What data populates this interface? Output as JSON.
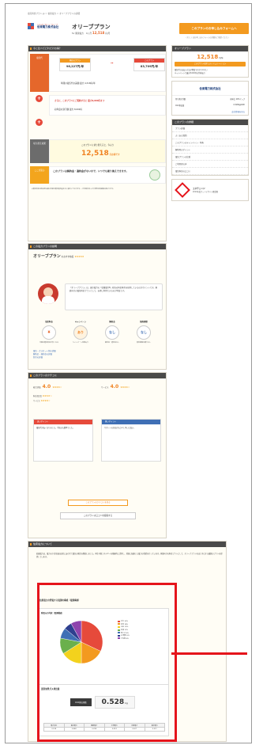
{
  "breadcrumb": "電気料金プラン.jp ＞ 伯東電力 ＞ オリーブプランの詳細",
  "company": {
    "name": "伯東電力株式会社",
    "tag": "エネルギーのニューウェーブ"
  },
  "plan": {
    "title": "オリーブプラン",
    "meta_prefix": "for 関東電力 　6ヶ月",
    "price": "12,518",
    "unit": "円/月"
  },
  "header_cta": {
    "label": "このプランのお申し込みフォームへ",
    "note": "くわしくはお申し込みフォームの詳細をご確認ください"
  },
  "summary": {
    "heading": "今と比べてどれだけお得？",
    "rows": [
      {
        "label": "電気代",
        "color": "#e5672b",
        "cols": [
          {
            "head": "現在のプラン",
            "value": "96,227円/年"
          },
          {
            "head": "このプラン",
            "value": "83,709円/年"
          }
        ],
        "note": "年間の電気代の差額 最大 4,518円/年",
        "highlight": "4,518"
      },
      {
        "label": "キャンペーン特典",
        "color": "#e64a3b",
        "lead": "さらに、このプランにご契約すると 最大8,000円オフ",
        "note": "初年度の割引額 最大 8,000円",
        "highlight": "8,000"
      },
      {
        "label": "切り替え効果",
        "color": "#6c6c6c",
        "lead": "このプランに切り替えると、今より",
        "value": "12,518",
        "unit": "円お得です"
      },
      {
        "label": "ここが安心",
        "color": "#f3a51d",
        "lead": "このプランは解約金・違約金がないので、いつでも乗り換えできます。"
      }
    ],
    "footnote": "※電気料金の削減見込額は年間の電気使用量を元に算出しております。ご利用状況により実際の削減額は異なります。"
  },
  "sidebar": {
    "plan_box": {
      "title": "オリーブプラン",
      "price": "12,518",
      "unit": "円/年",
      "cta": "このプランの詳しいシミュレーション"
    },
    "points": [
      "電気代の支払い方法が豊富でわかりやすい",
      "キャンペーンで最大8,000円の特典あり"
    ],
    "company_box": {
      "name": "伯東電力株式会社",
      "link": "会社情報を見る"
    },
    "stats": [
      {
        "k": "切り替え件数",
        "v": "前年比 20%アップ"
      },
      {
        "k": "CO2排出量",
        "v": "0.528kg/kWh"
      }
    ],
    "nav_head": "このプランの詳細",
    "nav_items": [
      "プラン詳細",
      "よくある質問",
      "このプランのキャンペーン・特典",
      "解約時のポイント",
      "電気プランの比較",
      "ご利用者の声",
      "電気料金の口コミ"
    ],
    "badge": {
      "title": "エネチェンジ",
      "sub": "2019年度グッドデザイン賞受賞"
    }
  },
  "about": {
    "heading": "この電力プランの説明",
    "title": "オリーブプラン",
    "sub": "のおすすめ度",
    "stars": "★★★★★",
    "bubble": "「オリーブプラン」は、東京電力の「従量電灯B」相当の料金体系を採用しているのがポイントです。家庭向けの電気料金プランとして、お得に利用できるのが特長です。",
    "features": [
      {
        "title": "電気料金",
        "icon": "¥",
        "desc": "年間の電気料金が安くなる"
      },
      {
        "title": "キャンペーン",
        "icon": "あり",
        "desc": "キャンペーン特典あり"
      },
      {
        "title": "解約金",
        "icon": "なし",
        "desc": "解約金・違約金なし"
      },
      {
        "title": "契約期間",
        "icon": "なし",
        "desc": "契約期間の縛りなし"
      }
    ],
    "links": [
      "電気・ガスセット割の詳細",
      "解約金・違約金の詳細",
      "割引の詳細"
    ]
  },
  "reviews": {
    "heading": "このプランのクチコミ",
    "scores": [
      {
        "k": "総合評価",
        "v": "4.0"
      },
      {
        "k": "サービス",
        "v": "4.0"
      }
    ],
    "sub_scores": [
      "料金満足度",
      "サービス",
      "手続き",
      "サポート"
    ],
    "cards": [
      {
        "head": "良いポイント",
        "color": "#e64a3b",
        "text": "電気代が安くなりました。手続きも簡単でした。"
      },
      {
        "head": "悪いポイント",
        "color": "#3f6fb5",
        "text": "サポートの対応がもう少し早いと良い。"
      }
    ],
    "more": "このプランのクチコミを見る",
    "more2": "このプランの口コミを投稿する"
  },
  "power": {
    "heading": "伯東電力について",
    "text": "伯東電力は、電力の小売全面自由化にあわせて電気の販売を開始しました。再生可能エネルギーを積極的に活用し、環境に配慮した電力の供給を行っています。家庭向けの料金プランとして、オリーブプランをはじめとする複数のプランを提供しています。",
    "mix_title": "伯東電力の発電する電源の構成（電源構成）",
    "mix_chart": {
      "type": "pie",
      "title": "発電元の内訳（電源構成）",
      "labels": [
        "水力",
        "石炭",
        "LNG",
        "石油",
        "再エネ",
        "FIT電気",
        "その他"
      ],
      "values": [
        32,
        18,
        16,
        12,
        8,
        6,
        8
      ],
      "colors": [
        "#e64a3b",
        "#f39a1f",
        "#f3d21d",
        "#6ab04c",
        "#3f6fb5",
        "#2e3f8f",
        "#8e44ad"
      ]
    },
    "co2_title": "温室効果ガス排出量",
    "co2_label": "CO2排出係数",
    "co2_value": "0.528",
    "co2_unit": "kg",
    "co2_table_head": [
      "電力会社",
      "東京電力",
      "関西電力",
      "中部電力",
      "北陸電力",
      "東北電力"
    ],
    "co2_table_vals": [
      "0.528",
      "0.468",
      "0.418",
      "0.474",
      "0.627",
      "0.521"
    ]
  }
}
